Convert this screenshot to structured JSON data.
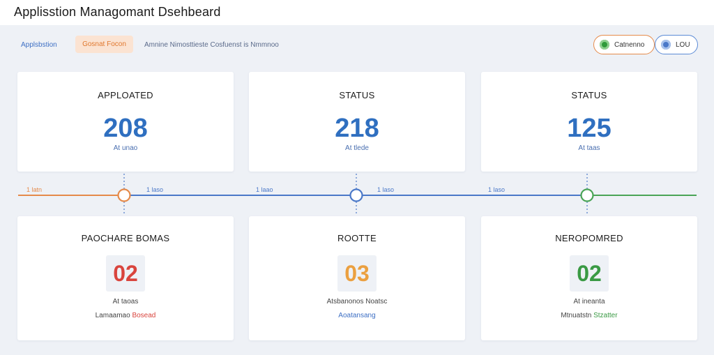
{
  "app": {
    "title": "Applisstion Managomant Dsehbeard"
  },
  "nav": {
    "link": "Applsbstion",
    "pill": "Gosnat Focon",
    "breadcrumb": "Amnine Nimosttieste Cosfuenst is Nmmnoo"
  },
  "header_chips": {
    "online_label": "Catnenno",
    "user_label": "LOU"
  },
  "stats": [
    {
      "label": "APPLOATED",
      "value": "208",
      "sub": "At unao"
    },
    {
      "label": "STATUS",
      "value": "218",
      "sub": "At tlede"
    },
    {
      "label": "STATUS",
      "value": "125",
      "sub": "At taas"
    }
  ],
  "timeline": {
    "labels": [
      "1 latn",
      "1 laso",
      "1 laao",
      "1 laso",
      "1 laso"
    ],
    "colors": {
      "orange": "#e58a4a",
      "blue": "#4a78c8",
      "green": "#4aa456"
    }
  },
  "details": [
    {
      "label": "PAOCHARE BOMAS",
      "value": "02",
      "value_color": "#d9443d",
      "sub1": "At taoas",
      "sub2_prefix": "Lamaamao",
      "sub2_accent": "Bosead"
    },
    {
      "label": "ROOTTE",
      "value": "03",
      "value_color": "#eba040",
      "sub1": "Atsbanonos Noatsc",
      "sub2": "Aoatansang"
    },
    {
      "label": "NEROPOMRED",
      "value": "02",
      "value_color": "#4aa456",
      "sub1": "At ineanta",
      "sub2_prefix": "Mtnuatstn",
      "sub2_accent": "Stzatter"
    }
  ]
}
